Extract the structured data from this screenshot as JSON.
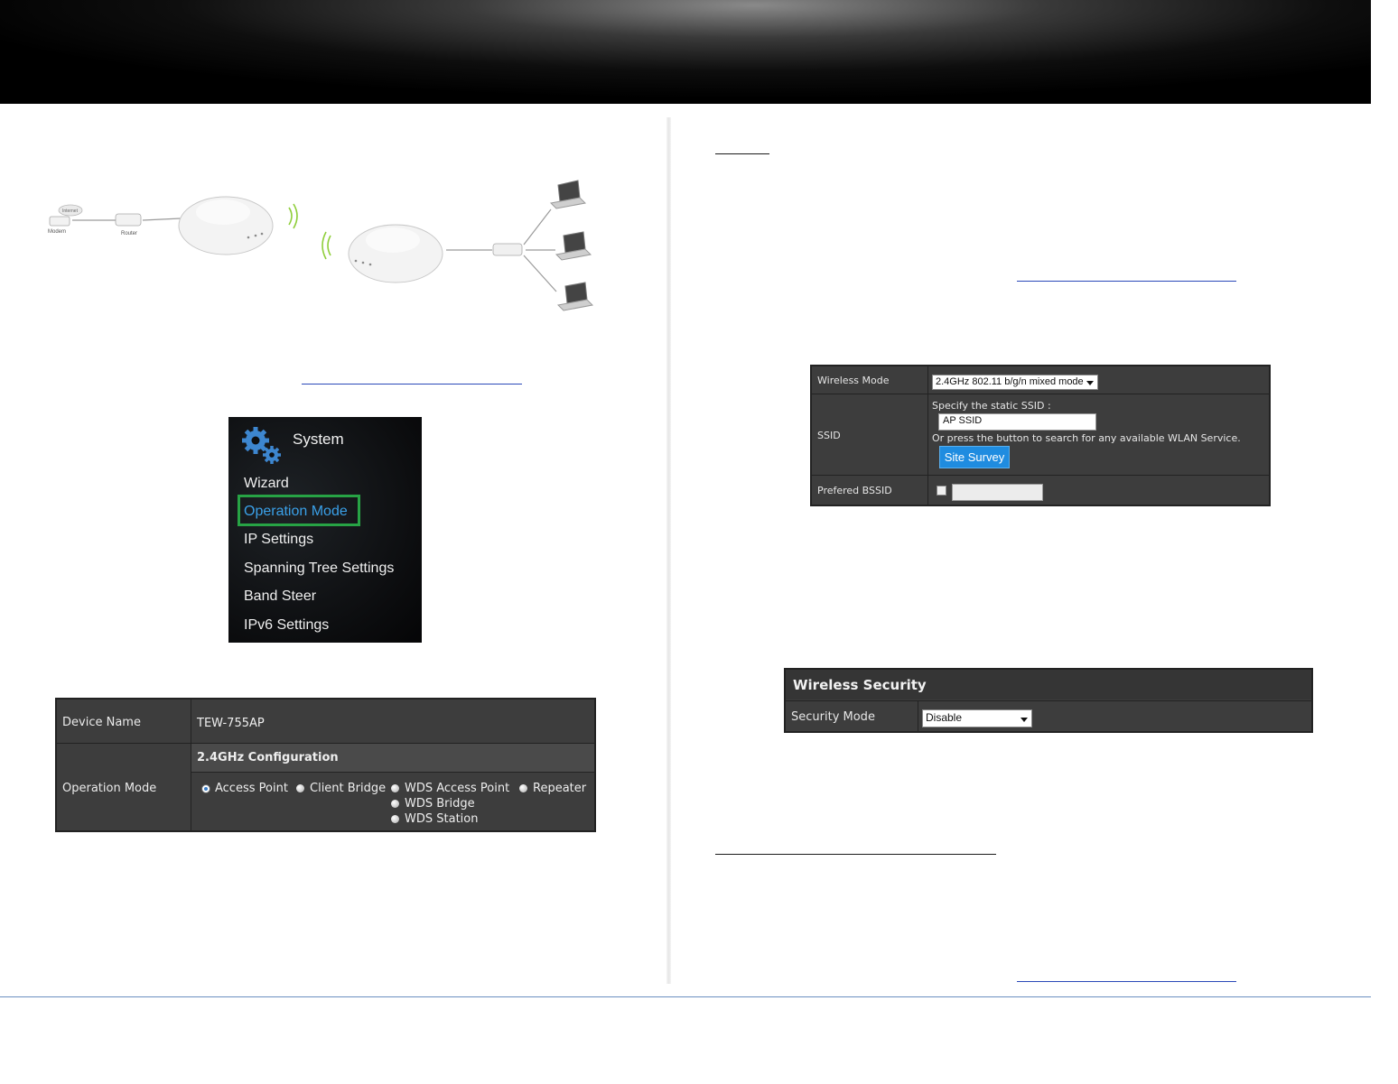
{
  "diagram": {
    "internet_label": "Internet",
    "modem_label": "Modem",
    "router_label": "Router"
  },
  "system_menu": {
    "title": "System",
    "items": [
      {
        "label": "Wizard",
        "active": false
      },
      {
        "label": "Operation Mode",
        "active": true
      },
      {
        "label": "IP Settings",
        "active": false
      },
      {
        "label": "Spanning Tree Settings",
        "active": false
      },
      {
        "label": "Band Steer",
        "active": false
      },
      {
        "label": "IPv6 Settings",
        "active": false
      }
    ]
  },
  "operation_panel": {
    "device_name_label": "Device Name",
    "device_name_value": "TEW-755AP",
    "operation_mode_label": "Operation Mode",
    "config_heading": "2.4GHz Configuration",
    "modes": [
      {
        "label": "Access Point",
        "selected": true
      },
      {
        "label": "Client Bridge",
        "selected": false
      },
      {
        "label": "WDS Access Point",
        "selected": false
      },
      {
        "label": "Repeater",
        "selected": false
      },
      {
        "label": "WDS Bridge",
        "selected": false
      },
      {
        "label": "WDS Station",
        "selected": false
      }
    ]
  },
  "wireless_panel": {
    "wireless_mode_label": "Wireless Mode",
    "wireless_mode_value": "2.4GHz 802.11 b/g/n mixed mode",
    "ssid_label": "SSID",
    "ssid_instruction": "Specify the static SSID :",
    "ssid_value": "AP SSID",
    "ssid_hint": "Or press the button to search for any available WLAN Service.",
    "site_survey_button": "Site Survey",
    "preferred_bssid_label": "Prefered BSSID",
    "preferred_bssid_value": ""
  },
  "security_panel": {
    "heading": "Wireless Security",
    "security_mode_label": "Security Mode",
    "security_mode_value": "Disable"
  },
  "colors": {
    "panel_bg": "#3d3d3d",
    "menu_active": "#3aa0e8",
    "highlight_box": "#27a345",
    "button_blue": "#1f8ce0",
    "footer_rule": "#6a8fc0",
    "link_rule": "#2a48b8"
  }
}
